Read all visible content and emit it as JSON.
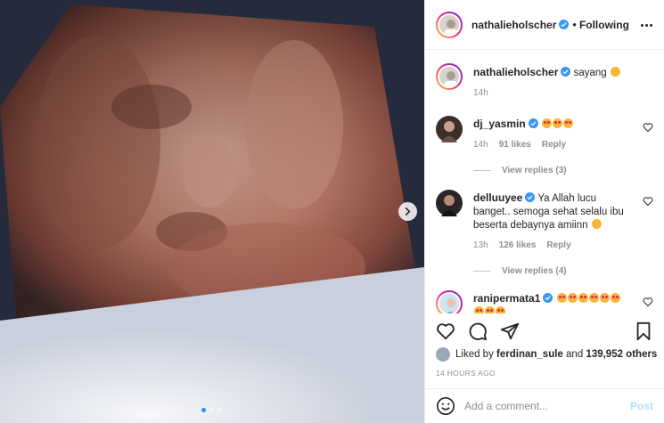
{
  "post": {
    "author": "nathalieholscher",
    "follow_state": "Following",
    "caption": "sayang",
    "caption_time": "14h",
    "carousel": {
      "count": 3,
      "active_index": 0
    }
  },
  "comments": [
    {
      "user": "dj_yasmin",
      "verified": true,
      "text": "",
      "emoji_count": 3,
      "time": "14h",
      "likes": "91 likes",
      "reply": "Reply",
      "view_replies": "View replies (3)"
    },
    {
      "user": "delluuyee",
      "verified": true,
      "text": "Ya Allah lucu banget.. semoga sehat selalu ibu beserta debaynya amiinn",
      "emoji_count": 1,
      "time": "13h",
      "likes": "126 likes",
      "reply": "Reply",
      "view_replies": "View replies (4)"
    },
    {
      "user": "ranipermata1",
      "verified": true,
      "text": "",
      "emoji_count": 9
    }
  ],
  "liked_by": {
    "prefix": "Liked by",
    "user": "ferdinan_sule",
    "and": "and",
    "others": "139,952 others"
  },
  "time_ago": "14 HOURS AGO",
  "add_comment": {
    "placeholder": "Add a comment...",
    "post_label": "Post"
  },
  "colors": {
    "verified": "#3897f0",
    "post_disabled": "#b2dffc",
    "dot_active": "#2196f3"
  },
  "icons": [
    "more-icon",
    "heart-icon",
    "comment-icon",
    "share-icon",
    "bookmark-icon",
    "smile-icon",
    "chevron-right-icon",
    "verified-icon"
  ]
}
